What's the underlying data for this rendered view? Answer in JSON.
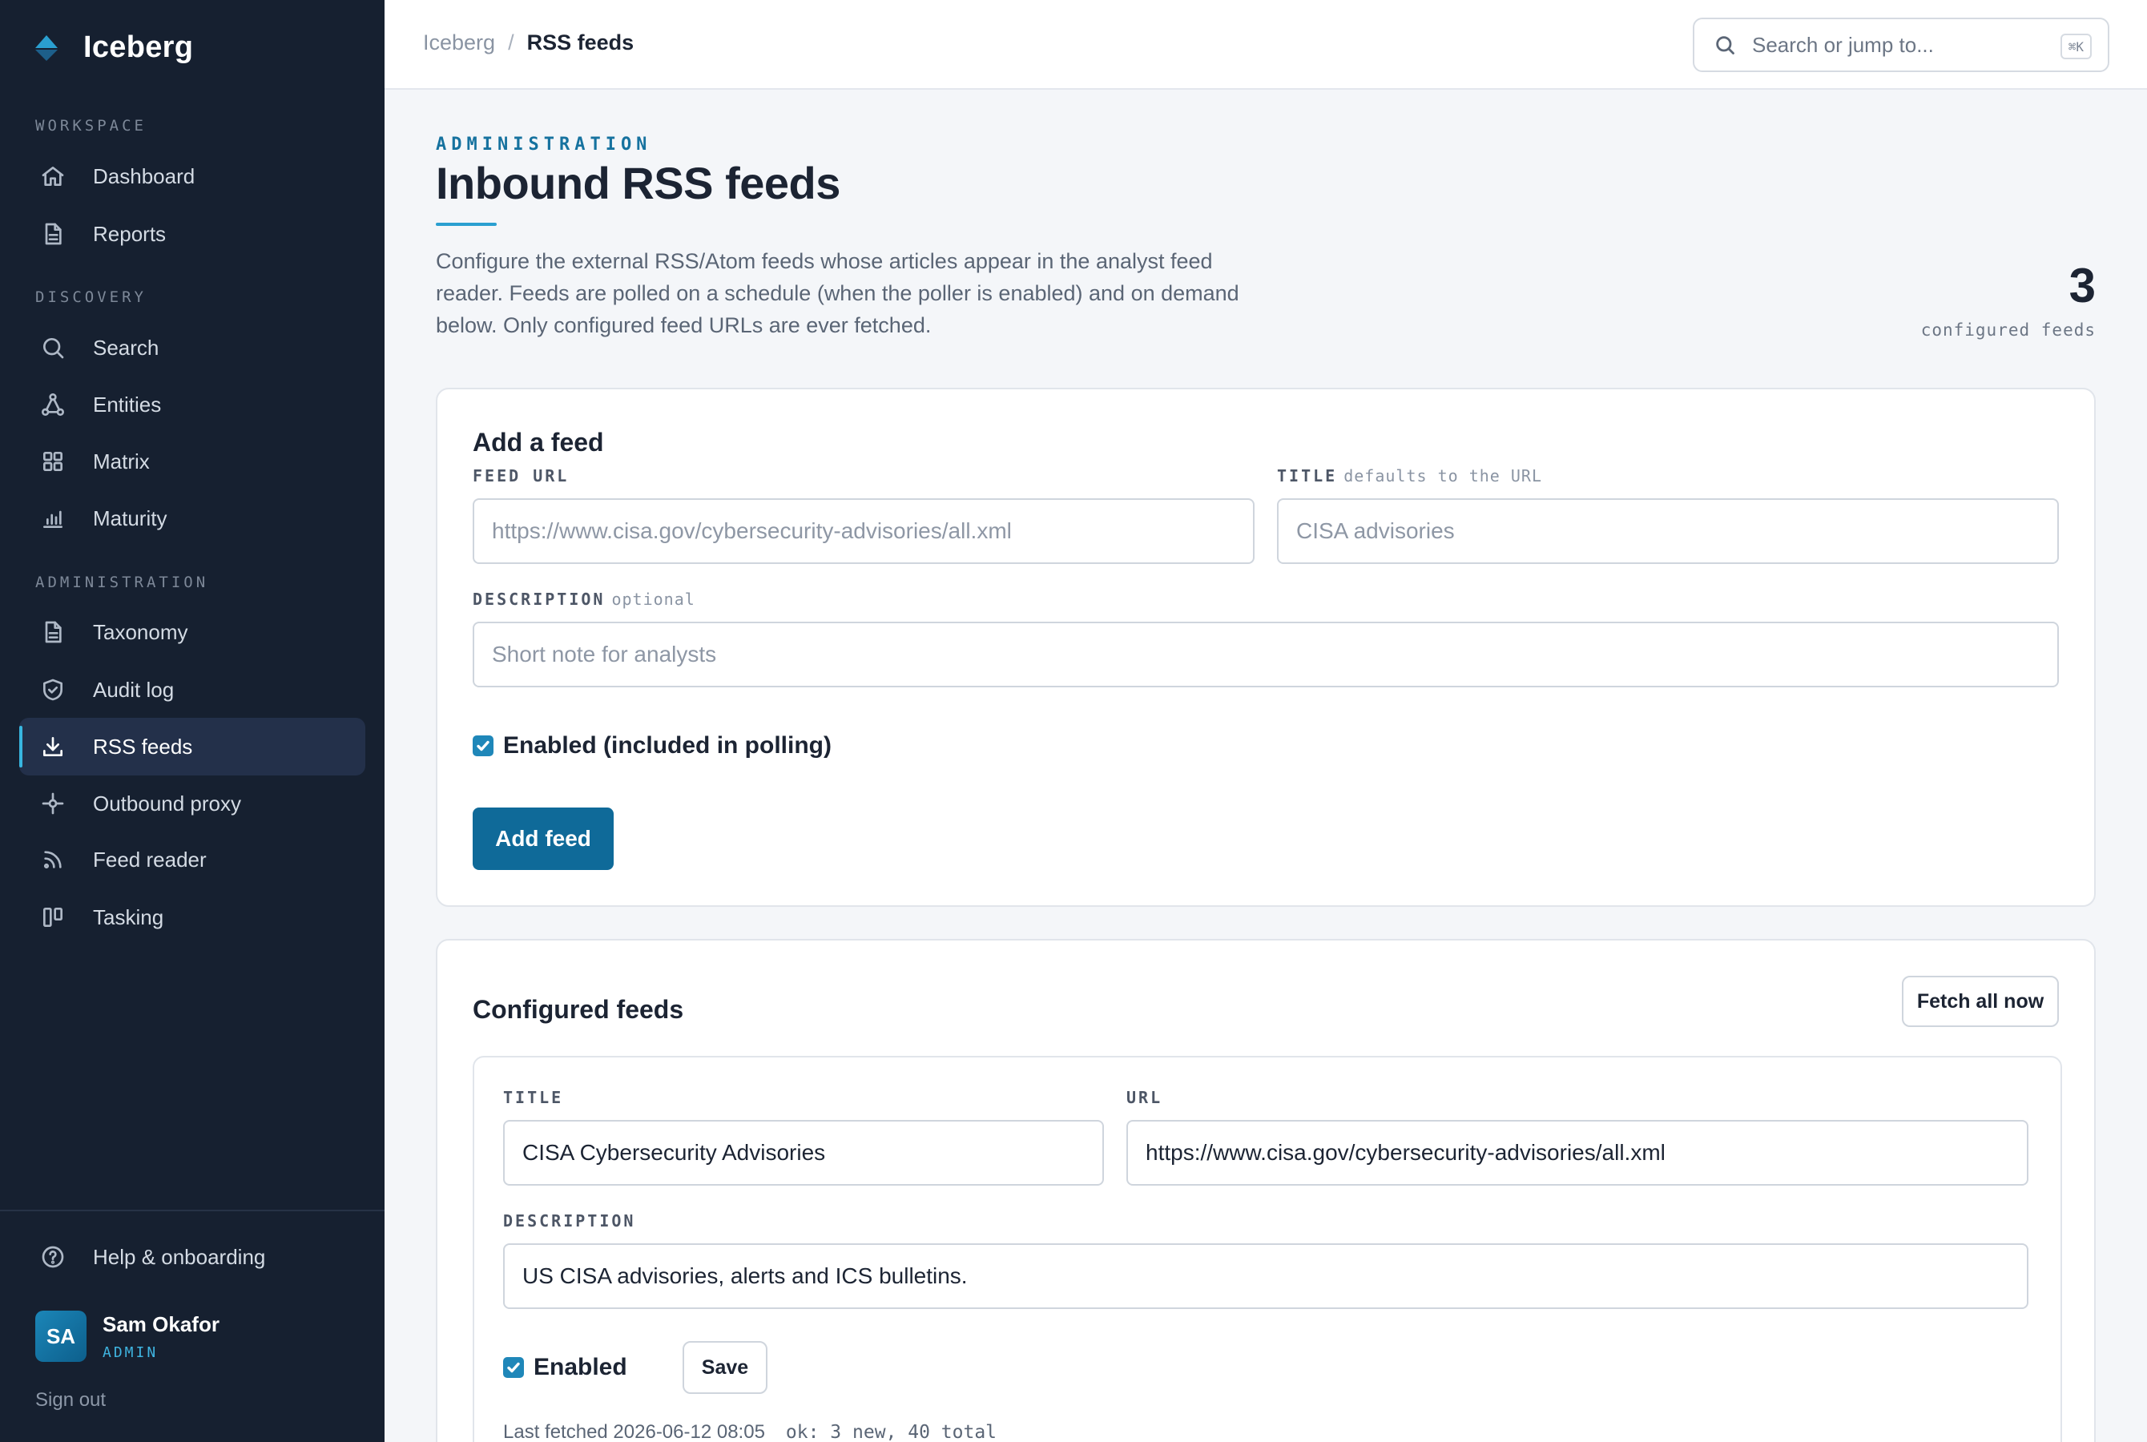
{
  "app": {
    "name": "Iceberg"
  },
  "sidebar": {
    "sections": [
      {
        "title": "WORKSPACE",
        "items": [
          {
            "label": "Dashboard",
            "icon": "home-icon"
          },
          {
            "label": "Reports",
            "icon": "document-icon"
          }
        ]
      },
      {
        "title": "DISCOVERY",
        "items": [
          {
            "label": "Search",
            "icon": "search-icon"
          },
          {
            "label": "Entities",
            "icon": "graph-icon"
          },
          {
            "label": "Matrix",
            "icon": "grid-icon"
          },
          {
            "label": "Maturity",
            "icon": "bar-chart-icon"
          }
        ]
      },
      {
        "title": "ADMINISTRATION",
        "items": [
          {
            "label": "Taxonomy",
            "icon": "document-icon"
          },
          {
            "label": "Audit log",
            "icon": "shield-icon"
          },
          {
            "label": "RSS feeds",
            "icon": "download-icon",
            "active": true
          },
          {
            "label": "Outbound proxy",
            "icon": "crosshair-icon"
          },
          {
            "label": "Feed reader",
            "icon": "rss-icon"
          },
          {
            "label": "Tasking",
            "icon": "kanban-icon"
          }
        ]
      }
    ],
    "help_label": "Help & onboarding",
    "user": {
      "initials": "SA",
      "name": "Sam Okafor",
      "role": "ADMIN"
    },
    "signout_label": "Sign out"
  },
  "topbar": {
    "breadcrumb": {
      "root": "Iceberg",
      "separator": "/",
      "current": "RSS feeds"
    },
    "search": {
      "placeholder": "Search or jump to...",
      "shortcut": "⌘K"
    }
  },
  "header": {
    "eyebrow": "ADMINISTRATION",
    "title": "Inbound RSS feeds",
    "description": "Configure the external RSS/Atom feeds whose articles appear in the analyst feed reader. Feeds are polled on a schedule (when the poller is enabled) and on demand below. Only configured feed URLs are ever fetched.",
    "stat_value": "3",
    "stat_label": "configured feeds"
  },
  "add_feed": {
    "title": "Add a feed",
    "url_label": "FEED URL",
    "url_placeholder": "https://www.cisa.gov/cybersecurity-advisories/all.xml",
    "title_label": "TITLE",
    "title_hint": "defaults to the URL",
    "title_placeholder": "CISA advisories",
    "description_label": "DESCRIPTION",
    "description_hint": "optional",
    "description_placeholder": "Short note for analysts",
    "enabled_label": "Enabled (included in polling)",
    "enabled": true,
    "submit_label": "Add feed"
  },
  "configured": {
    "title": "Configured feeds",
    "fetch_all_label": "Fetch all now",
    "feeds": [
      {
        "title_label": "TITLE",
        "title": "CISA Cybersecurity Advisories",
        "url_label": "URL",
        "url": "https://www.cisa.gov/cybersecurity-advisories/all.xml",
        "description_label": "DESCRIPTION",
        "description": "US CISA advisories, alerts and ICS bulletins.",
        "enabled_label": "Enabled",
        "enabled": true,
        "save_label": "Save",
        "last_fetched": "Last fetched 2026-06-12 08:05",
        "status": "ok: 3 new, 40 total"
      }
    ]
  },
  "colors": {
    "sidebar_bg": "#162030",
    "accent": "#0f6a99",
    "active_indicator": "#38b6e0"
  }
}
